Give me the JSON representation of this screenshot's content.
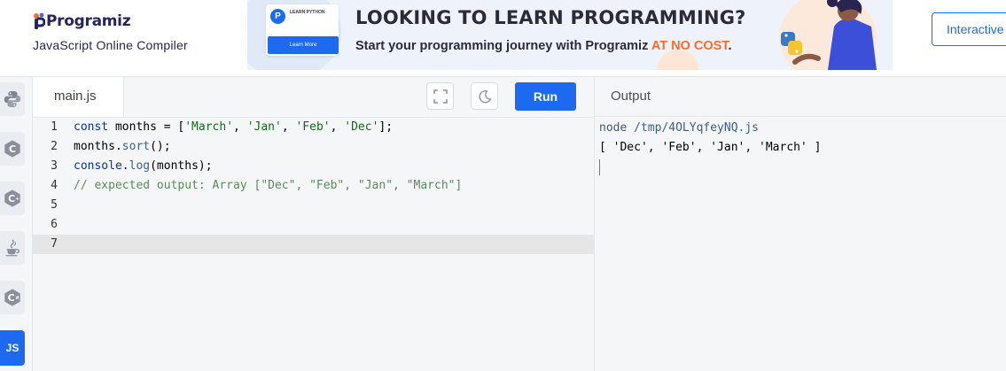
{
  "header": {
    "brand": "Programiz",
    "subtitle": "JavaScript Online Compiler",
    "interactive_label": "Interactive"
  },
  "banner": {
    "card_tag": "LEARN PYTHON",
    "card_button": "Learn More",
    "headline": "LOOKING TO LEARN PROGRAMMING?",
    "subline_prefix": "Start your programming journey with Programiz ",
    "subline_highlight": "AT NO COST",
    "subline_suffix": ".",
    "highlight_color": "#ff6a28"
  },
  "sidebar": {
    "languages": [
      {
        "name": "python",
        "icon": "python-icon"
      },
      {
        "name": "c",
        "icon": "c-icon"
      },
      {
        "name": "cpp",
        "icon": "cpp-icon"
      },
      {
        "name": "java",
        "icon": "java-icon"
      },
      {
        "name": "csharp",
        "icon": "csharp-icon"
      },
      {
        "name": "javascript",
        "label": "JS",
        "active": true
      }
    ]
  },
  "editor": {
    "file_tab": "main.js",
    "fullscreen_icon": "fullscreen-icon",
    "theme_icon": "moon-icon",
    "run_label": "Run",
    "accent": "#1d6af0",
    "lines": [
      {
        "num": "1",
        "text": "const months = ['March', 'Jan', 'Feb', 'Dec'];"
      },
      {
        "num": "2",
        "text": "months.sort();"
      },
      {
        "num": "3",
        "text": "console.log(months);"
      },
      {
        "num": "4",
        "text": "// expected output: Array [\"Dec\", \"Feb\", \"Jan\", \"March\"]"
      },
      {
        "num": "5",
        "text": ""
      },
      {
        "num": "6",
        "text": ""
      },
      {
        "num": "7",
        "text": ""
      }
    ]
  },
  "output": {
    "title": "Output",
    "command": "node /tmp/4OLYqfeyNQ.js",
    "result": "[ 'Dec', 'Feb', 'Jan', 'March' ]"
  }
}
